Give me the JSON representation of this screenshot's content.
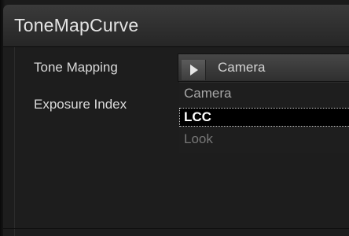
{
  "window": {
    "title": "ToneMapCurve"
  },
  "fields": {
    "tone_mapping_label": "Tone Mapping",
    "exposure_index_label": "Exposure Index"
  },
  "tone_mapping_select": {
    "selected": "Camera",
    "options": [
      {
        "label": "Camera"
      },
      {
        "label": "LCC"
      },
      {
        "label": "Look"
      }
    ],
    "highlighted_index": 1
  }
}
